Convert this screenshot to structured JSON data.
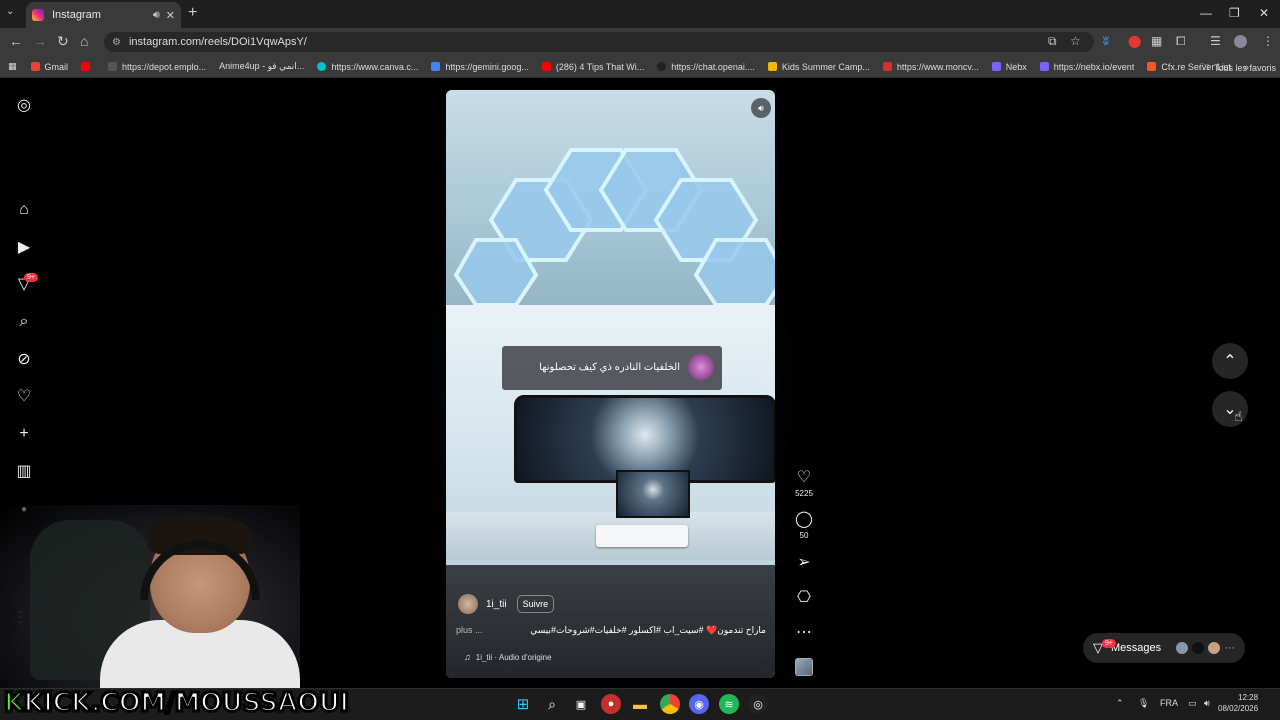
{
  "browser": {
    "tab_title": "Instagram",
    "url": "instagram.com/reels/DOi1VqwApsY/",
    "bookmarks": [
      {
        "label": "Gmail",
        "color": "#ea4335"
      },
      {
        "label": "",
        "color": "#ff0000"
      },
      {
        "label": "https://depot.emplo...",
        "color": "#555555"
      },
      {
        "label": "Anime4up - انمي فو...",
        "color": "#444444"
      },
      {
        "label": "https://www.canva.c...",
        "color": "#00c4cc"
      },
      {
        "label": "https://gemini.goog...",
        "color": "#4285f4"
      },
      {
        "label": "(286) 4 Tips That Wi...",
        "color": "#ff0000"
      },
      {
        "label": "https://chat.openai....",
        "color": "#222222"
      },
      {
        "label": "Kids Summer Camp...",
        "color": "#f4b400"
      },
      {
        "label": "https://www.moncv...",
        "color": "#d93025"
      },
      {
        "label": "Nebx",
        "color": "#7b61ff"
      },
      {
        "label": "https://nebx.io/event",
        "color": "#7b61ff"
      },
      {
        "label": "Cfx.re Server List",
        "color": "#f15a24"
      }
    ],
    "all_bookmarks_label": "Tous les favoris"
  },
  "sidebar": {
    "notification_badge": "9+"
  },
  "reel": {
    "overlay_caption": "الخلفيات النادره ذي كيف تحصلونها",
    "author": "1i_tii",
    "follow_label": "Suivre",
    "caption": "ماراح تندمون❤️ #سيت_اب #اكسلور #خلفيات#شروحات#بيسي",
    "more_label": "plus ...",
    "audio": "1i_tii · Audio d'origine"
  },
  "actions": {
    "likes": "5225",
    "comments": "50"
  },
  "messages": {
    "label": "Messages",
    "badge": "9+"
  },
  "stream": {
    "banner_k": "K",
    "banner_text": "KICK.COM/MOUSSAOUI"
  },
  "system": {
    "lang": "FRA",
    "time": "12:28",
    "date": "08/02/2026"
  },
  "colors": {
    "accent_red": "#ff3040",
    "kick_green": "#53fc18"
  }
}
